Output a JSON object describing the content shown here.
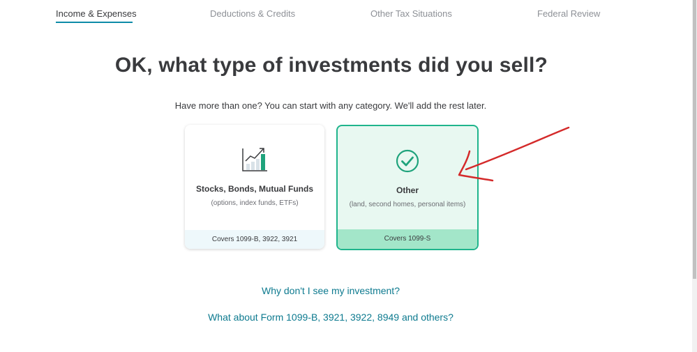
{
  "tabs": [
    {
      "label": "Income & Expenses",
      "active": true
    },
    {
      "label": "Deductions & Credits",
      "active": false
    },
    {
      "label": "Other Tax Situations",
      "active": false
    },
    {
      "label": "Federal Review",
      "active": false
    }
  ],
  "heading": "OK, what type of investments did you sell?",
  "subheading": "Have more than one? You can start with any category. We'll add the rest later.",
  "cards": [
    {
      "icon": "chart-growth-icon",
      "title": "Stocks, Bonds, Mutual Funds",
      "description": "(options, index funds, ETFs)",
      "footer": "Covers 1099-B, 3922, 3921",
      "selected": false
    },
    {
      "icon": "check-circle-icon",
      "title": "Other",
      "description": "(land, second homes, personal items)",
      "footer": "Covers 1099-S",
      "selected": true
    }
  ],
  "links": {
    "why_not_investment": "Why don't I see my investment?",
    "about_forms": "What about Form 1099-B, 3921, 3922, 8949 and others?"
  },
  "colors": {
    "accent_teal": "#0d8ba8",
    "selected_border": "#1fb48c",
    "selected_bg": "#e8f8f1",
    "selected_footer": "#a3e6c9",
    "annotation_red": "#d42a2a",
    "text_dark": "#393a3d",
    "link": "#0d7a8f"
  }
}
